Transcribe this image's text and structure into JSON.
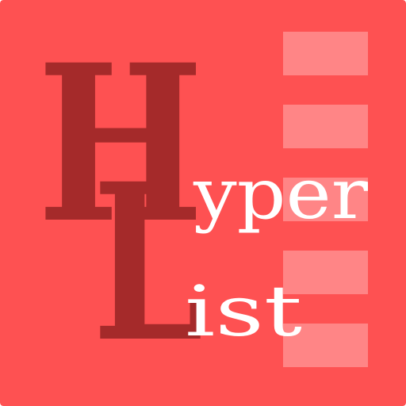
{
  "logo": {
    "big_letter_1": "H",
    "big_letter_2": "L",
    "word_1": "yper",
    "word_2": "ist",
    "colors": {
      "background": "#fe5152",
      "stripe": "#ff8586",
      "dark_letters": "#a52a2a",
      "light_text": "#ffffff"
    }
  }
}
